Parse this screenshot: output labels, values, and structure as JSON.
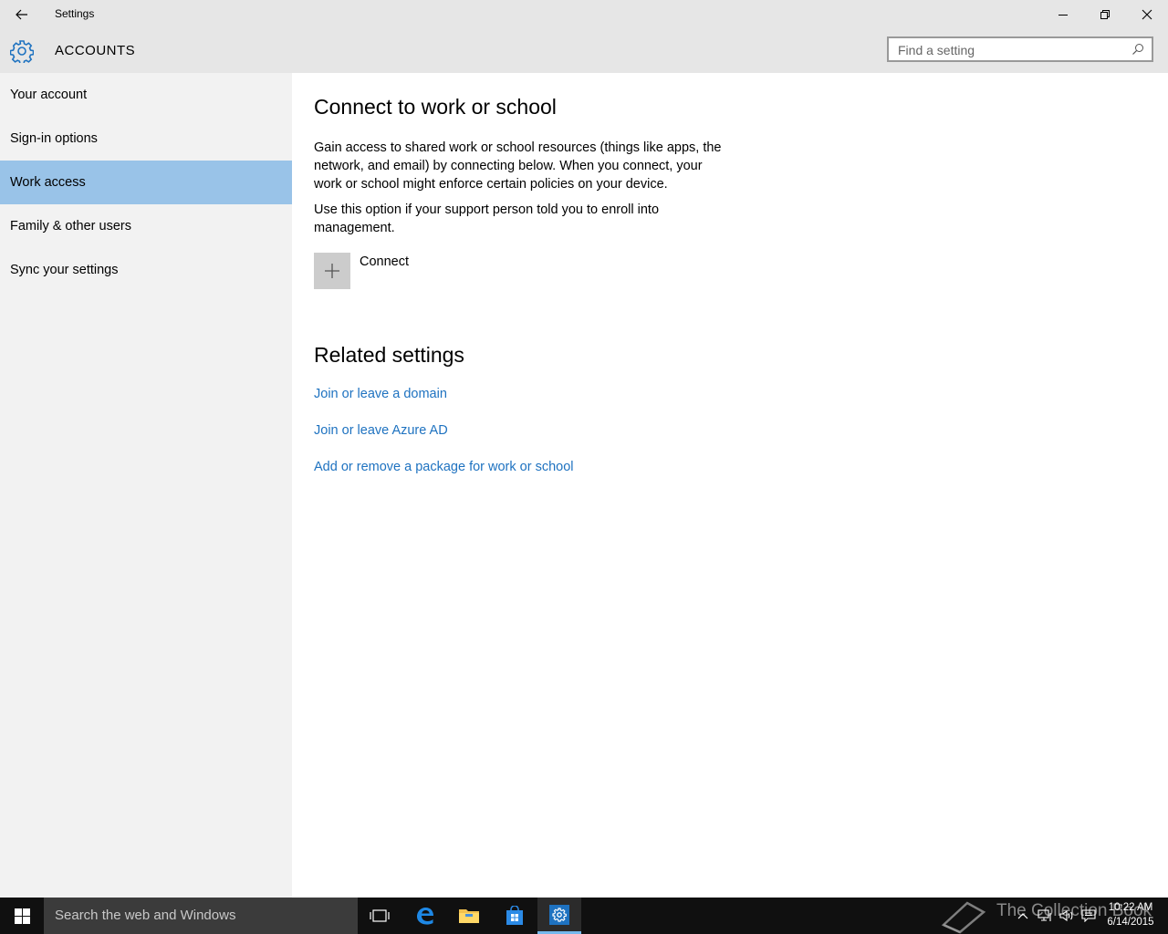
{
  "window": {
    "title": "Settings"
  },
  "header": {
    "section": "ACCOUNTS",
    "search_placeholder": "Find a setting"
  },
  "sidebar": {
    "items": [
      {
        "label": "Your account",
        "selected": false
      },
      {
        "label": "Sign-in options",
        "selected": false
      },
      {
        "label": "Work access",
        "selected": true
      },
      {
        "label": "Family & other users",
        "selected": false
      },
      {
        "label": "Sync your settings",
        "selected": false
      }
    ]
  },
  "main": {
    "title": "Connect to work or school",
    "description": "Gain access to shared work or school resources (things like apps, the network, and email) by connecting below. When you connect, your work or school might enforce certain policies on your device.",
    "enroll_note": "Use this option if your support person told you to enroll into management.",
    "connect_label": "Connect",
    "related_title": "Related settings",
    "related_links": [
      "Join or leave a domain",
      "Join or leave Azure AD",
      "Add or remove a package for work or school"
    ]
  },
  "taskbar": {
    "search_placeholder": "Search the web and Windows",
    "watermark": "The Collection Book",
    "time": "10:22 AM",
    "date": "6/14/2015"
  },
  "colors": {
    "accent": "#1e72c0",
    "selected_nav": "#99c3e8",
    "sidebar_bg": "#f2f2f2",
    "header_bg": "#e6e6e6",
    "taskbar_bg": "#101010"
  },
  "icons": {
    "back": "back-arrow-icon",
    "minimize": "minimize-icon",
    "maximize": "restore-icon",
    "close": "close-icon",
    "settings": "gear-icon",
    "search": "search-icon",
    "add": "plus-icon"
  }
}
